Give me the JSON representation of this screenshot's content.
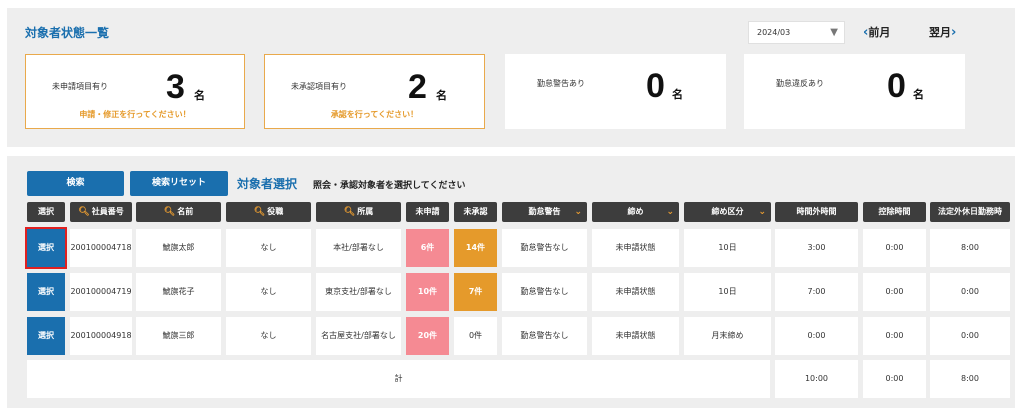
{
  "summary": {
    "title": "対象者状態一覧",
    "month": "2024/03",
    "prev_label": "前月",
    "next_label": "翌月",
    "cards": [
      {
        "label": "未申請項目有り",
        "count": "3",
        "unit": "名",
        "note": "申請・修正を行ってください！"
      },
      {
        "label": "未承認項目有り",
        "count": "2",
        "unit": "名",
        "note": "承認を行ってください！"
      },
      {
        "label": "勤怠警告あり",
        "count": "0",
        "unit": "名",
        "note": ""
      },
      {
        "label": "勤怠違反あり",
        "count": "0",
        "unit": "名",
        "note": ""
      }
    ]
  },
  "list": {
    "search_label": "検索",
    "reset_label": "検索リセット",
    "title": "対象者選択",
    "note": "照会・承認対象者を選択してください",
    "headers": [
      "選択",
      "社員番号",
      "名前",
      "役職",
      "所属",
      "未申請",
      "未承認",
      "勤怠警告",
      "締め",
      "締め区分",
      "時間外時間",
      "控除時間",
      "法定外休日勤務時"
    ],
    "rows": [
      {
        "select": "選択",
        "id": "200100004718",
        "name": "鯱旗太郎",
        "role": "なし",
        "dept": "本社/部署なし",
        "unapplied": "6件",
        "unapproved": "14件",
        "warning": "勤怠警告なし",
        "closing": "未申請状態",
        "closing_type": "10日",
        "overtime": "3:00",
        "deduction": "0:00",
        "holiday": "8:00"
      },
      {
        "select": "選択",
        "id": "200100004719",
        "name": "鯱旗花子",
        "role": "なし",
        "dept": "東京支社/部署なし",
        "unapplied": "10件",
        "unapproved": "7件",
        "warning": "勤怠警告なし",
        "closing": "未申請状態",
        "closing_type": "10日",
        "overtime": "7:00",
        "deduction": "0:00",
        "holiday": "0:00"
      },
      {
        "select": "選択",
        "id": "200100004918",
        "name": "鯱旗三郎",
        "role": "なし",
        "dept": "名古屋支社/部署なし",
        "unapplied": "20件",
        "unapproved": "0件",
        "warning": "勤怠警告なし",
        "closing": "未申請状態",
        "closing_type": "月末締め",
        "overtime": "0:00",
        "deduction": "0:00",
        "holiday": "0:00"
      }
    ],
    "total": {
      "label": "計",
      "overtime": "10:00",
      "deduction": "0:00",
      "holiday": "8:00"
    }
  },
  "icons": {
    "search": "search-icon",
    "dropdown": "chevron-down-icon"
  },
  "colors": {
    "accent": "#1a6fae",
    "warning": "#e59a2b",
    "alert": "#f58a93",
    "header": "#3d3d3d"
  }
}
